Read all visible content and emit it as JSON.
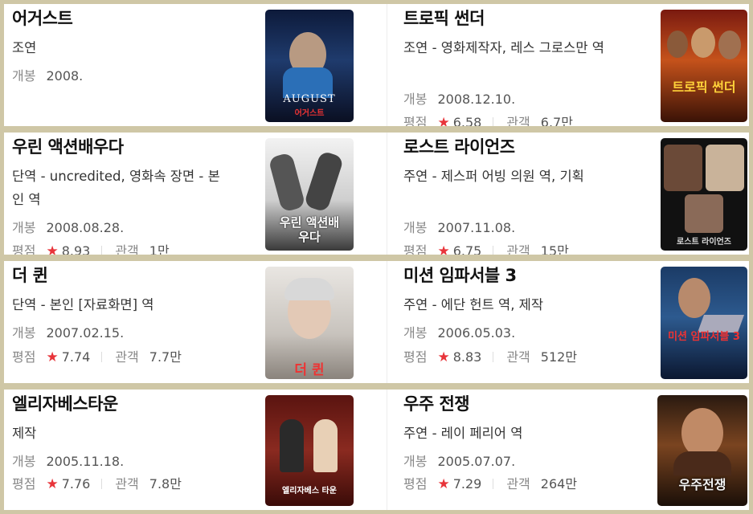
{
  "labels": {
    "release": "개봉",
    "rating": "평점",
    "audience": "관객"
  },
  "accent": "#e8343a",
  "movies": [
    {
      "title": "어거스트",
      "role": "조연",
      "release": "2008.",
      "poster_text": "AUGUST",
      "poster_sub": "어거스트"
    },
    {
      "title": "트로픽 썬더",
      "role": "조연 - 영화제작자, 레스 그로스만 역",
      "release": "2008.12.10.",
      "rating": "6.58",
      "audience": "6.7만",
      "poster_text": "트로픽 썬더"
    },
    {
      "title": "우린 액션배우다",
      "role": "단역 - uncredited, 영화속 장면 - 본인 역",
      "release": "2008.08.28.",
      "rating": "8.93",
      "audience": "1만",
      "poster_text": "우린 액션배우다"
    },
    {
      "title": "로스트 라이언즈",
      "role": "주연 - 제스퍼 어빙 의원 역, 기획",
      "release": "2007.11.08.",
      "rating": "6.75",
      "audience": "15만",
      "poster_text": "로스트 라이언즈"
    },
    {
      "title": "더 퀸",
      "role": "단역 - 본인 [자료화면] 역",
      "release": "2007.02.15.",
      "rating": "7.74",
      "audience": "7.7만",
      "poster_text": "더 퀸"
    },
    {
      "title": "미션 임파서블 3",
      "role": "주연 - 에단 헌트 역, 제작",
      "release": "2006.05.03.",
      "rating": "8.83",
      "audience": "512만",
      "poster_text": "미션 임파서블 3"
    },
    {
      "title": "엘리자베스타운",
      "role": "제작",
      "release": "2005.11.18.",
      "rating": "7.76",
      "audience": "7.8만",
      "poster_text": "엘리자베스 타운"
    },
    {
      "title": "우주 전쟁",
      "role": "주연 - 레이 페리어 역",
      "release": "2005.07.07.",
      "rating": "7.29",
      "audience": "264만",
      "poster_text": "우주전쟁"
    }
  ]
}
